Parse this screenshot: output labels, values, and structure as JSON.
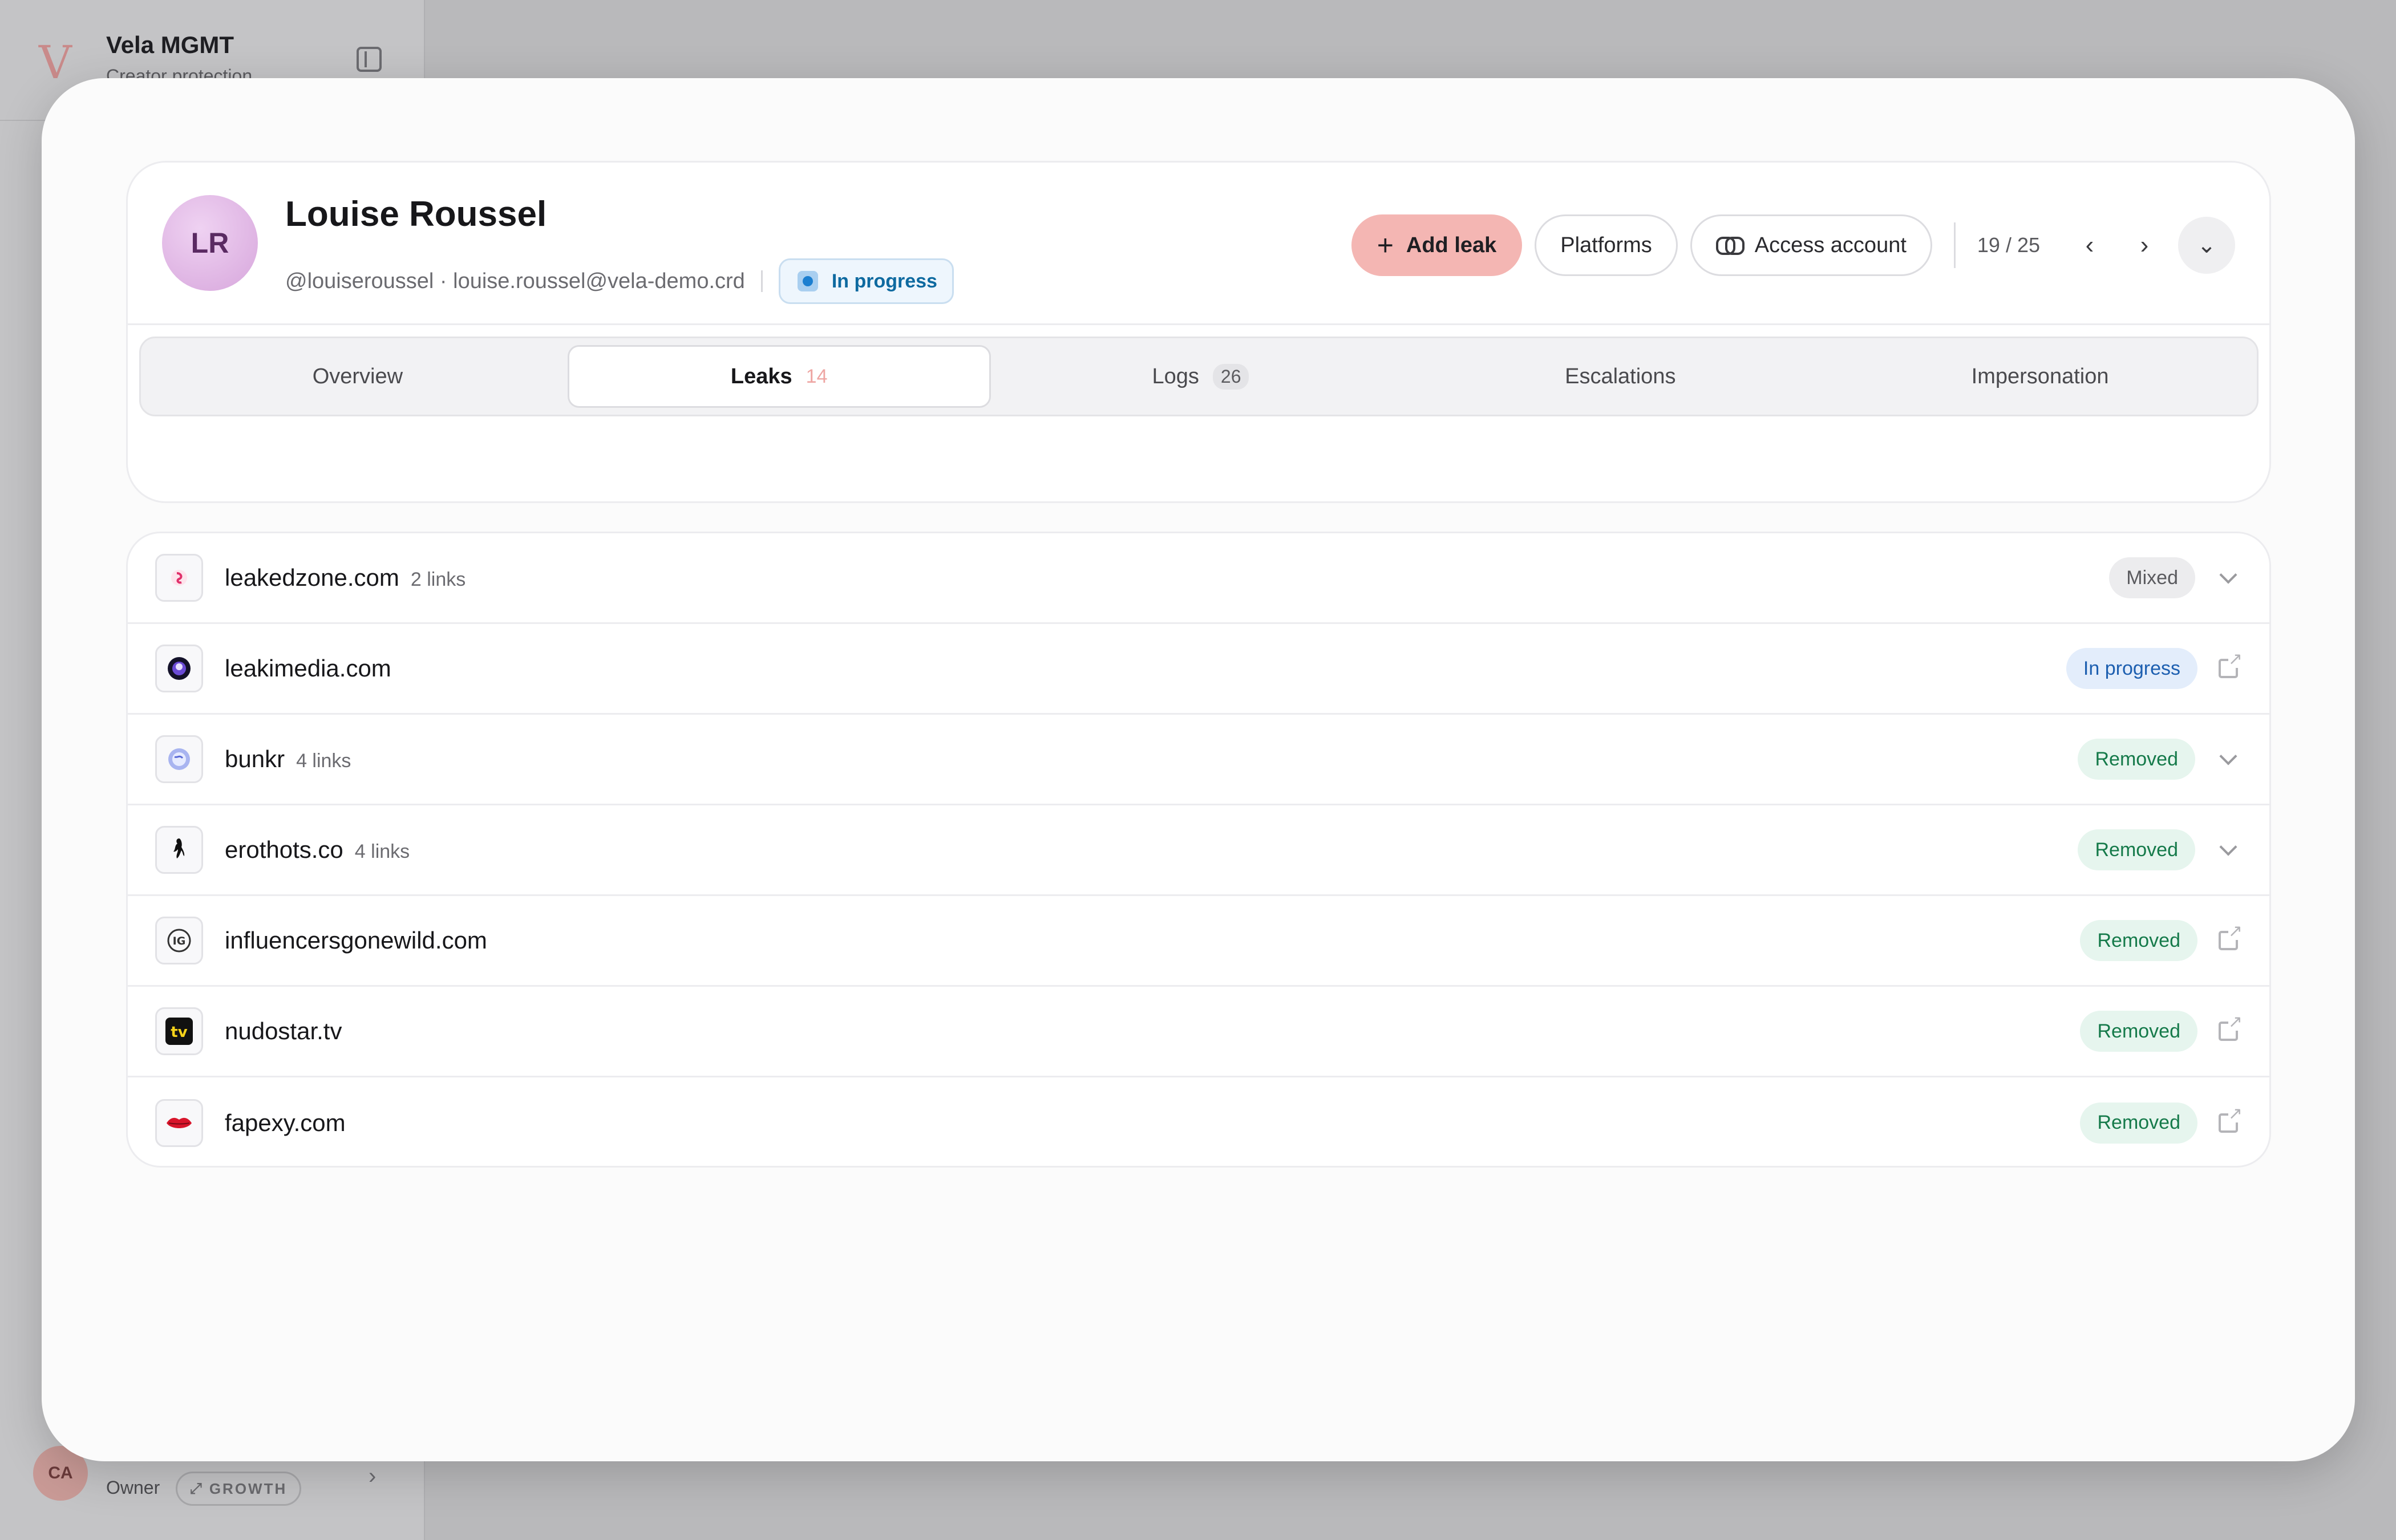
{
  "app": {
    "name": "Vela MGMT",
    "subtitle": "Creator protection",
    "user_initials": "CA",
    "user_role": "Owner",
    "plan": "GROWTH"
  },
  "profile": {
    "initials": "LR",
    "name": "Louise Roussel",
    "meta": "@louiseroussel · louise.roussel@vela-demo.crd",
    "status": "In progress"
  },
  "actions": {
    "add_leak": "Add leak",
    "platforms": "Platforms",
    "access_account": "Access account",
    "pager": "19 / 25"
  },
  "tabs": [
    {
      "label": "Overview",
      "count": ""
    },
    {
      "label": "Leaks",
      "count": "14"
    },
    {
      "label": "Logs",
      "count": "26"
    },
    {
      "label": "Escalations",
      "count": ""
    },
    {
      "label": "Impersonation",
      "count": ""
    }
  ],
  "leaks": [
    {
      "domain": "leakedzone.com",
      "links": "2 links",
      "status": "Mixed",
      "action": "expand",
      "icon": "leakedzone-favicon"
    },
    {
      "domain": "leakimedia.com",
      "links": "",
      "status": "In progress",
      "action": "external-link",
      "icon": "leakimedia-favicon"
    },
    {
      "domain": "bunkr",
      "links": "4 links",
      "status": "Removed",
      "action": "expand",
      "icon": "bunkr-favicon"
    },
    {
      "domain": "erothots.co",
      "links": "4 links",
      "status": "Removed",
      "action": "expand",
      "icon": "erothots-favicon"
    },
    {
      "domain": "influencersgonewild.com",
      "links": "",
      "status": "Removed",
      "action": "external-link",
      "icon": "influencersgonewild-favicon"
    },
    {
      "domain": "nudostar.tv",
      "links": "",
      "status": "Removed",
      "action": "external-link",
      "icon": "nudostar-favicon"
    },
    {
      "domain": "fapexy.com",
      "links": "",
      "status": "Removed",
      "action": "external-link",
      "icon": "fapexy-favicon"
    }
  ]
}
